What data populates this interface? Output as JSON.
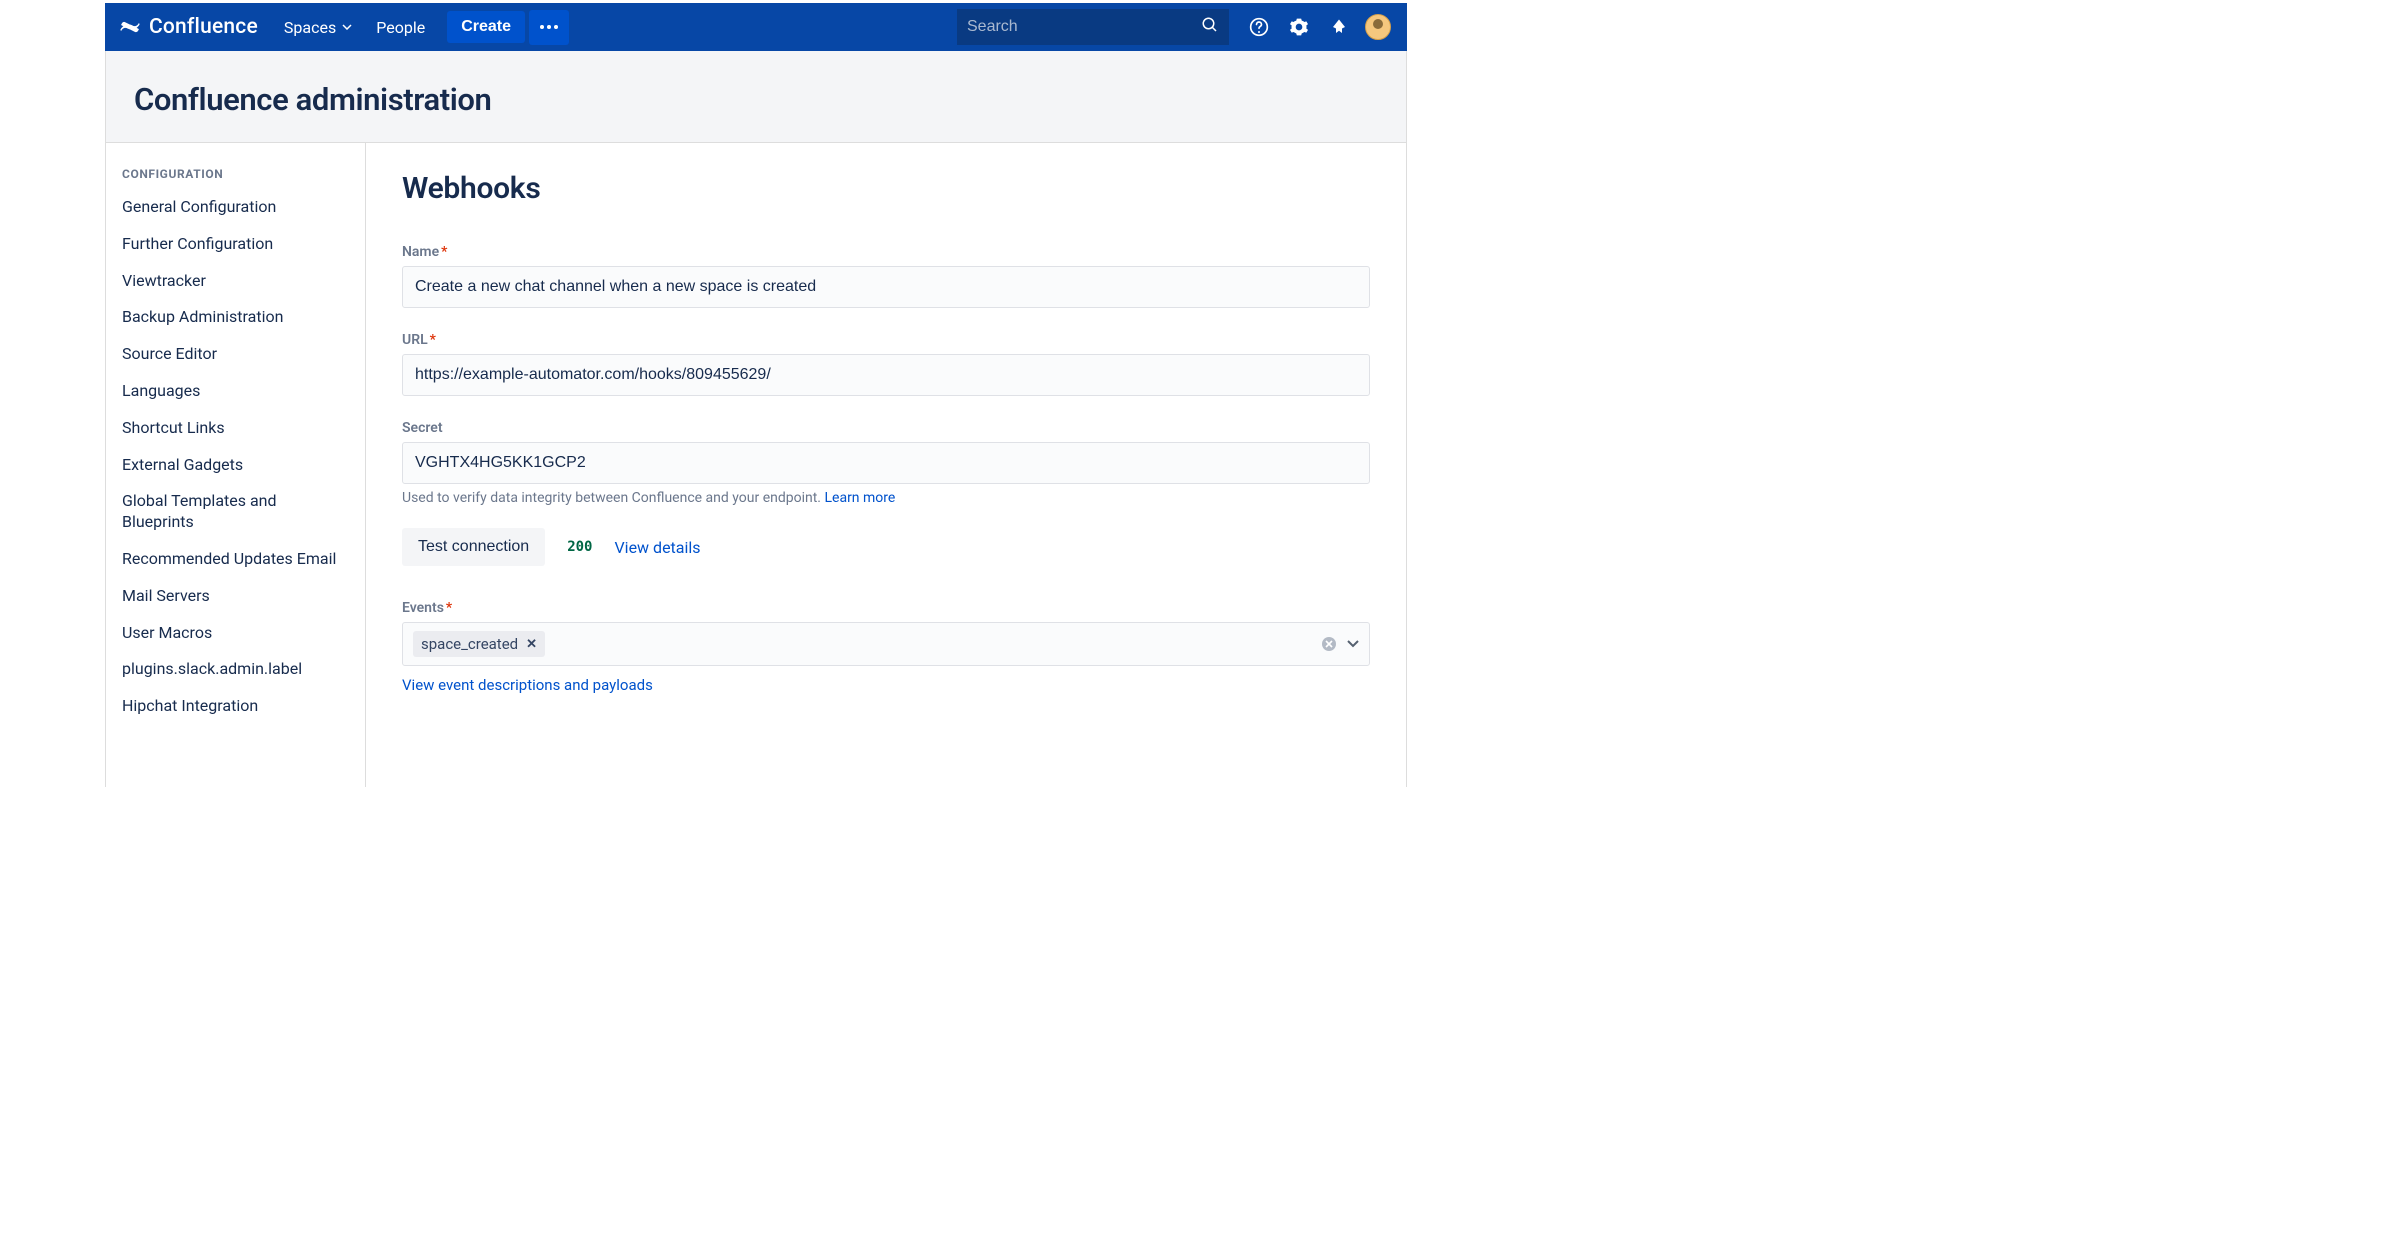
{
  "topbar": {
    "logo_text": "Confluence",
    "spaces_label": "Spaces",
    "people_label": "People",
    "create_label": "Create",
    "search_placeholder": "Search"
  },
  "header": {
    "title": "Confluence administration"
  },
  "sidebar": {
    "heading": "CONFIGURATION",
    "items": [
      "General Configuration",
      "Further Configuration",
      "Viewtracker",
      "Backup Administration",
      "Source Editor",
      "Languages",
      "Shortcut Links",
      "External Gadgets",
      "Global Templates and Blueprints",
      "Recommended Updates Email",
      "Mail Servers",
      "User Macros",
      "plugins.slack.admin.label",
      "Hipchat Integration"
    ]
  },
  "main": {
    "title": "Webhooks",
    "name_label": "Name",
    "name_value": "Create a new chat channel when a new space is created",
    "url_label": "URL",
    "url_value": "https://example-automator.com/hooks/809455629/",
    "secret_label": "Secret",
    "secret_value": "VGHTX4HG5KK1GCP2",
    "secret_help": "Used to verify data integrity between Confluence and your endpoint. ",
    "learn_more": "Learn more",
    "test_label": "Test connection",
    "status_code": "200",
    "view_details": "View details",
    "events_label": "Events",
    "event_chip": "space_created",
    "event_link": "View event descriptions and payloads"
  }
}
